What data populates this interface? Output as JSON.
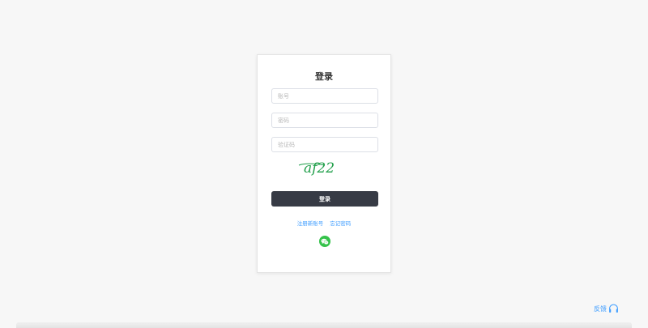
{
  "login": {
    "title": "登录",
    "account_placeholder": "账号",
    "password_placeholder": "密码",
    "captcha_placeholder": "验证码",
    "captcha_text": "af22",
    "login_label": "登录",
    "register_link": "注册新账号",
    "forgot_link": "忘记密码"
  },
  "feedback": {
    "label": "反馈"
  },
  "colors": {
    "accent": "#409eff",
    "button": "#373b45",
    "wechat": "#34c24a",
    "captcha": "#1f9e49"
  },
  "icons": [
    "wechat-icon",
    "headset-icon"
  ]
}
